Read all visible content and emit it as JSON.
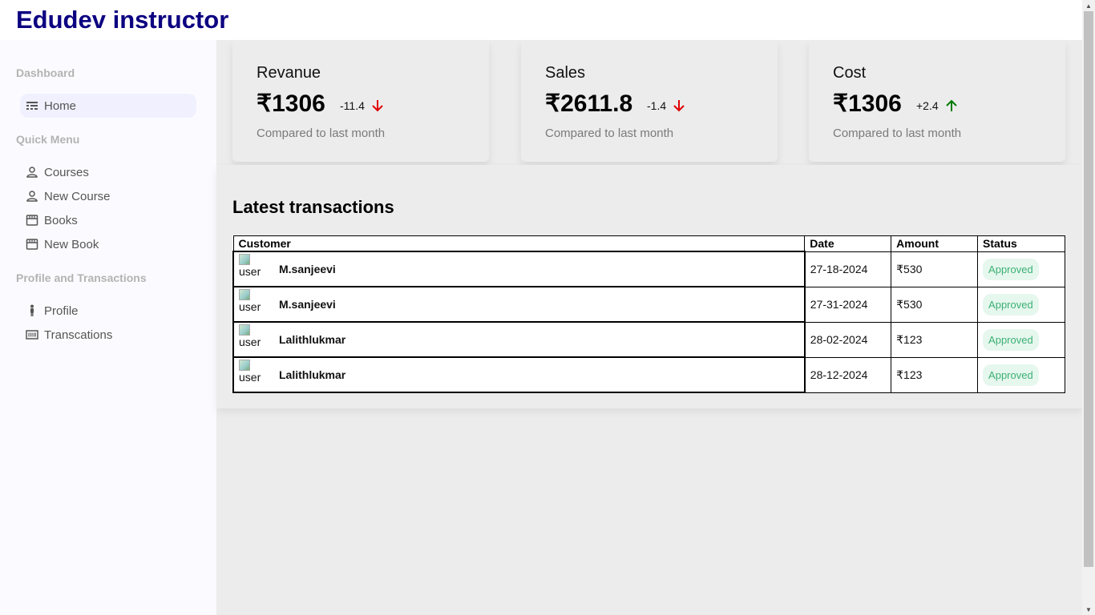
{
  "header": {
    "brand": "Edudev instructor"
  },
  "sidebar": {
    "sections": [
      {
        "title": "Dashboard",
        "items": [
          {
            "label": "Home",
            "icon": "table-rows-icon"
          }
        ]
      },
      {
        "title": "Quick Menu",
        "items": [
          {
            "label": "Courses",
            "icon": "person-icon"
          },
          {
            "label": "New Course",
            "icon": "person-icon"
          },
          {
            "label": "Books",
            "icon": "storefront-icon"
          },
          {
            "label": "New Book",
            "icon": "storefront-icon"
          }
        ]
      },
      {
        "title": "Profile and Transactions",
        "items": [
          {
            "label": "Profile",
            "icon": "standing-person-icon"
          },
          {
            "label": "Transcations",
            "icon": "barcode-icon"
          }
        ]
      }
    ]
  },
  "kpis": [
    {
      "title": "Revanue",
      "money": "₹1306",
      "rate": "-11.4",
      "trend": "down",
      "sub": "Compared to last month"
    },
    {
      "title": "Sales",
      "money": "₹2611.8",
      "rate": "-1.4",
      "trend": "down",
      "sub": "Compared to last month"
    },
    {
      "title": "Cost",
      "money": "₹1306",
      "rate": "+2.4",
      "trend": "up",
      "sub": "Compared to last month"
    }
  ],
  "colors": {
    "trend_down": "#e00000",
    "trend_up": "#007a00",
    "brand": "#0c0080"
  },
  "transactions": {
    "title": "Latest transactions",
    "headers": [
      "Customer",
      "Date",
      "Amount",
      "Status"
    ],
    "avatar_alt": "user",
    "rows": [
      {
        "name": "M.sanjeevi",
        "date": "27-18-2024",
        "amount": "₹530",
        "status": "Approved"
      },
      {
        "name": "M.sanjeevi",
        "date": "27-31-2024",
        "amount": "₹530",
        "status": "Approved"
      },
      {
        "name": "Lalithlukmar",
        "date": "28-02-2024",
        "amount": "₹123",
        "status": "Approved"
      },
      {
        "name": "Lalithlukmar",
        "date": "28-12-2024",
        "amount": "₹123",
        "status": "Approved"
      }
    ]
  }
}
